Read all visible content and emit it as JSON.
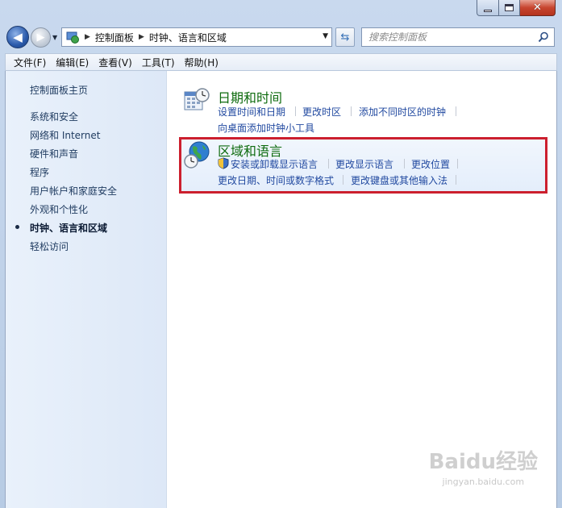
{
  "window": {
    "minimize_glyph": "",
    "close_glyph": "✕"
  },
  "nav": {
    "breadcrumbs": [
      "控制面板",
      "时钟、语言和区域"
    ],
    "search_placeholder": "搜索控制面板"
  },
  "menu": [
    "文件(F)",
    "编辑(E)",
    "查看(V)",
    "工具(T)",
    "帮助(H)"
  ],
  "sidebar": {
    "items": [
      {
        "label": "控制面板主页",
        "active": false
      },
      {
        "label": "系统和安全",
        "active": false
      },
      {
        "label": "网络和 Internet",
        "active": false
      },
      {
        "label": "硬件和声音",
        "active": false
      },
      {
        "label": "程序",
        "active": false
      },
      {
        "label": "用户帐户和家庭安全",
        "active": false
      },
      {
        "label": "外观和个性化",
        "active": false
      },
      {
        "label": "时钟、语言和区域",
        "active": true
      },
      {
        "label": "轻松访问",
        "active": false
      }
    ]
  },
  "categories": [
    {
      "title": "日期和时间",
      "tasks": [
        "设置时间和日期",
        "更改时区",
        "添加不同时区的时钟",
        "向桌面添加时钟小工具"
      ]
    },
    {
      "title": "区域和语言",
      "tasks": [
        "安装或卸载显示语言",
        "更改显示语言",
        "更改位置",
        "更改日期、时间或数字格式",
        "更改键盘或其他输入法"
      ]
    }
  ],
  "watermark": {
    "brand": "Baidu经验",
    "url": "jingyan.baidu.com"
  },
  "colors": {
    "highlight_border": "#cc1f2e",
    "category_title": "#0e6b0e",
    "task_link": "#2149a0"
  }
}
